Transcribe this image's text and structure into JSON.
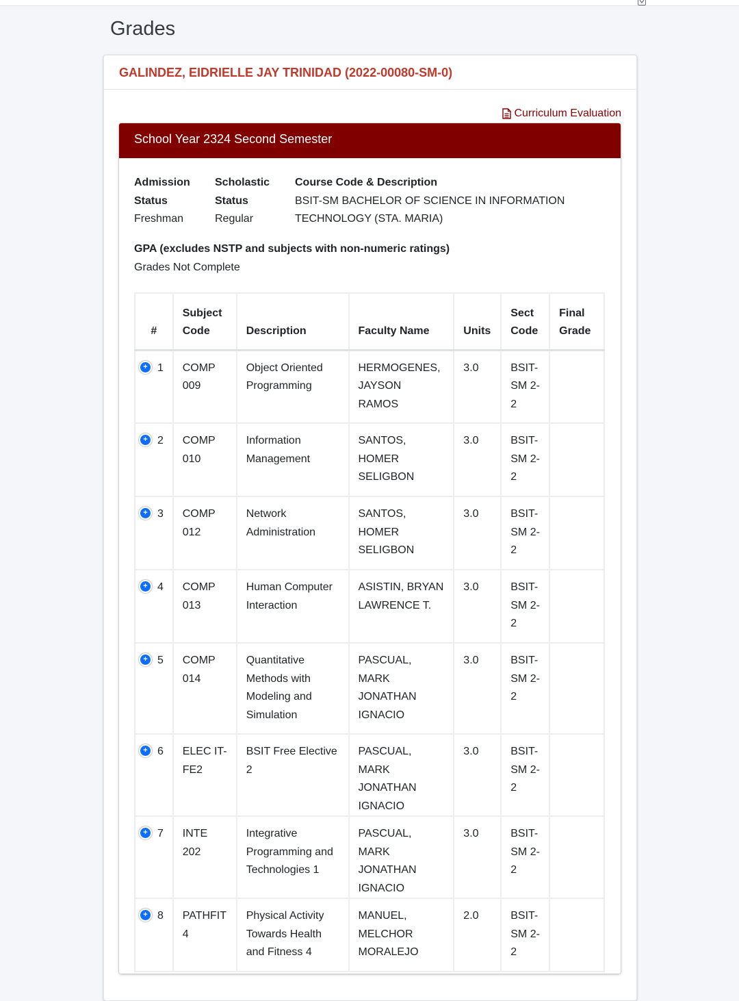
{
  "page": {
    "title": "Grades"
  },
  "student": {
    "name": "GALINDEZ, EIDRIELLE JAY TRINIDAD (2022-00080-SM-0)"
  },
  "links": {
    "curriculum_evaluation": "Curriculum Evaluation"
  },
  "semester": {
    "title": "School Year 2324 Second Semester",
    "admission_status": {
      "label_line1": "Admission",
      "label_line2": "Status",
      "value": "Freshman"
    },
    "scholastic_status": {
      "label_line1": "Scholastic",
      "label_line2": "Status",
      "value": "Regular"
    },
    "course": {
      "label": "Course Code & Description",
      "value_line1": "BSIT-SM BACHELOR OF SCIENCE IN INFORMATION",
      "value_line2": "TECHNOLOGY (STA. MARIA)"
    },
    "gpa": {
      "label": "GPA (excludes NSTP and subjects with non-numeric ratings)",
      "value": "Grades Not Complete"
    }
  },
  "table": {
    "headers": {
      "num": "#",
      "code_l1": "Subject",
      "code_l2": "Code",
      "description": "Description",
      "faculty": "Faculty Name",
      "units": "Units",
      "sect_l1": "Sect",
      "sect_l2": "Code",
      "grade_l1": "Final",
      "grade_l2": "Grade"
    },
    "rows": [
      {
        "num": "1",
        "code": [
          "COMP",
          "009"
        ],
        "desc": [
          "Object Oriented",
          "Programming"
        ],
        "faculty": [
          "HERMOGENES,",
          "JAYSON RAMOS"
        ],
        "units": "3.0",
        "sect": [
          "BSIT-",
          "SM 2-",
          "2"
        ],
        "grade": ""
      },
      {
        "num": "2",
        "code": [
          "COMP",
          "010"
        ],
        "desc": [
          "Information",
          "Management"
        ],
        "faculty": [
          "SANTOS, HOMER",
          "SELIGBON"
        ],
        "units": "3.0",
        "sect": [
          "BSIT-",
          "SM 2-",
          "2"
        ],
        "grade": ""
      },
      {
        "num": "3",
        "code": [
          "COMP",
          "012"
        ],
        "desc": [
          "Network",
          "Administration"
        ],
        "faculty": [
          "SANTOS, HOMER",
          "SELIGBON"
        ],
        "units": "3.0",
        "sect": [
          "BSIT-",
          "SM 2-",
          "2"
        ],
        "grade": ""
      },
      {
        "num": "4",
        "code": [
          "COMP",
          "013"
        ],
        "desc": [
          "Human Computer",
          "Interaction"
        ],
        "faculty": [
          "ASISTIN, BRYAN",
          "LAWRENCE T."
        ],
        "units": "3.0",
        "sect": [
          "BSIT-",
          "SM 2-",
          "2"
        ],
        "grade": ""
      },
      {
        "num": "5",
        "code": [
          "COMP",
          "014"
        ],
        "desc": [
          "Quantitative",
          "Methods with",
          "Modeling and",
          "Simulation"
        ],
        "faculty": [
          "PASCUAL, MARK",
          "JONATHAN",
          "IGNACIO"
        ],
        "units": "3.0",
        "sect": [
          "BSIT-",
          "SM 2-",
          "2"
        ],
        "grade": ""
      },
      {
        "num": "6",
        "code": [
          "ELEC IT-",
          "FE2"
        ],
        "desc": [
          "BSIT Free Elective",
          "2"
        ],
        "faculty": [
          "PASCUAL, MARK",
          "JONATHAN",
          "IGNACIO"
        ],
        "units": "3.0",
        "sect": [
          "BSIT-",
          "SM 2-",
          "2"
        ],
        "grade": ""
      },
      {
        "num": "7",
        "code": [
          "INTE 202"
        ],
        "desc": [
          "Integrative",
          "Programming and",
          "Technologies 1"
        ],
        "faculty": [
          "PASCUAL, MARK",
          "JONATHAN",
          "IGNACIO"
        ],
        "units": "3.0",
        "sect": [
          "BSIT-",
          "SM 2-",
          "2"
        ],
        "grade": ""
      },
      {
        "num": "8",
        "code": [
          "PATHFIT",
          "4"
        ],
        "desc": [
          "Physical Activity",
          "Towards Health",
          "and Fitness 4"
        ],
        "faculty": [
          "MANUEL,",
          "MELCHOR",
          "MORALEJO"
        ],
        "units": "2.0",
        "sect": [
          "BSIT-",
          "SM 2-",
          "2"
        ],
        "grade": ""
      }
    ]
  },
  "icons": {
    "expand": "plus-circle-icon",
    "document": "file-text-icon",
    "topbar": "caret-down-icon"
  }
}
